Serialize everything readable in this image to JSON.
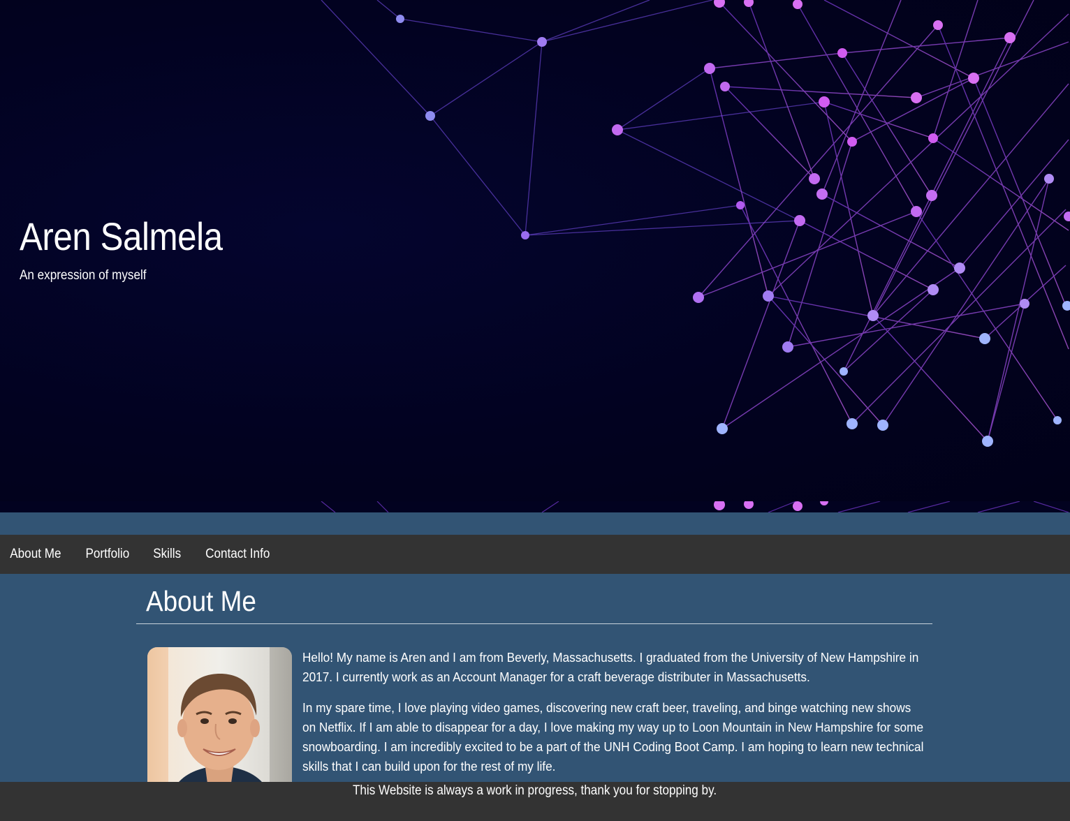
{
  "hero": {
    "title": "Aren Salmela",
    "subtitle": "An expression of myself"
  },
  "nav": {
    "items": [
      {
        "label": "About Me"
      },
      {
        "label": "Portfolio"
      },
      {
        "label": "Skills"
      },
      {
        "label": "Contact Info"
      }
    ]
  },
  "about": {
    "title": "About Me",
    "paragraphs": [
      "Hello! My name is Aren and I am from Beverly, Massachusetts. I graduated from the University of New Hampshire in 2017. I currently work as an Account Manager for a craft beverage distributer in Massachusetts.",
      "In my spare time, I love playing video games, discovering new craft beer, traveling, and binge watching new shows on Netflix. If I am able to disappear for a day, I love making my way up to Loon Mountain in New Hampshire for some snowboarding. I am incredibly excited to be a part of the UNH Coding Boot Camp. I am hoping to learn new technical skills that I can build upon for the rest of my life."
    ]
  },
  "footer": {
    "text": "This Website is always a work in progress, thank you for stopping by."
  },
  "colors": {
    "page_background": "#325474",
    "bar_background": "#333333",
    "hero_background": "#020220",
    "network_purple": "#b25bf0",
    "network_blue": "#9fb4ff"
  }
}
